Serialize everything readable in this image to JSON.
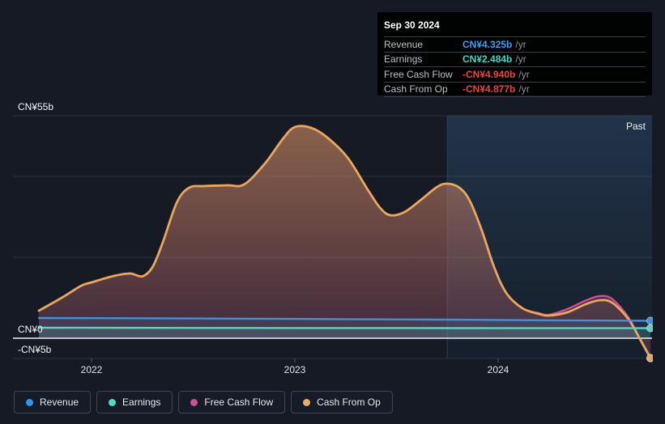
{
  "tooltip": {
    "date": "Sep 30 2024",
    "rows": [
      {
        "label": "Revenue",
        "value": "CN¥4.325b",
        "suffix": "/yr",
        "value_color": "#3aa0f4"
      },
      {
        "label": "Earnings",
        "value": "CN¥2.484b",
        "suffix": "/yr",
        "value_color": "#3fd6c6"
      },
      {
        "label": "Free Cash Flow",
        "value": "-CN¥4.940b",
        "suffix": "/yr",
        "value_color": "#e8453e"
      },
      {
        "label": "Cash From Op",
        "value": "-CN¥4.877b",
        "suffix": "/yr",
        "value_color": "#e8453e"
      }
    ]
  },
  "legend": {
    "items": [
      {
        "label": "Revenue",
        "color": "#2b97f1"
      },
      {
        "label": "Earnings",
        "color": "#4fdcc7"
      },
      {
        "label": "Free Cash Flow",
        "color": "#cf4e96"
      },
      {
        "label": "Cash From Op",
        "color": "#e9ae5a"
      }
    ]
  },
  "chart": {
    "past_label": "Past",
    "y_axis_labels": [
      {
        "value": 55,
        "label": "CN¥55b"
      },
      {
        "value": 0,
        "label": "CN¥0"
      },
      {
        "value": -5,
        "label": "-CN¥5b"
      }
    ],
    "x_axis_labels": [
      {
        "t": 2022,
        "label": "2022"
      },
      {
        "t": 2023,
        "label": "2023"
      },
      {
        "t": 2024,
        "label": "2024"
      }
    ]
  },
  "chart_data": {
    "type": "area",
    "title": "Past earnings and revenue history",
    "x_unit": "decimal_year",
    "y_unit": "CN¥ billions",
    "xlim": [
      2021.6,
      2024.78
    ],
    "ylim": [
      -5,
      55
    ],
    "gridlines_y": [
      55,
      40,
      20,
      -5
    ],
    "zero_line_y": 0,
    "past_band_start": 2023.75,
    "legend_position": "bottom",
    "end_values": {
      "revenue": 4.325,
      "earnings": 2.484,
      "free_cash_flow": -4.94,
      "cash_from_op": -4.877
    },
    "series": [
      {
        "name": "Free Cash Flow",
        "color": "#cf4e96",
        "width": 2.4,
        "fill_opacity": 0.2,
        "dot": true,
        "points": [
          [
            2021.741,
            6.8
          ],
          [
            2021.86,
            10.2
          ],
          [
            2021.95,
            13.0
          ],
          [
            2022.0,
            13.8
          ],
          [
            2022.11,
            15.4
          ],
          [
            2022.19,
            16.0
          ],
          [
            2022.25,
            15.3
          ],
          [
            2022.3,
            17.6
          ],
          [
            2022.35,
            23.6
          ],
          [
            2022.42,
            33.6
          ],
          [
            2022.48,
            37.2
          ],
          [
            2022.55,
            37.6
          ],
          [
            2022.67,
            37.8
          ],
          [
            2022.75,
            38.0
          ],
          [
            2022.85,
            43.0
          ],
          [
            2022.94,
            49.2
          ],
          [
            2023.0,
            52.2
          ],
          [
            2023.08,
            52.0
          ],
          [
            2023.16,
            49.6
          ],
          [
            2023.26,
            44.6
          ],
          [
            2023.36,
            36.6
          ],
          [
            2023.42,
            32.2
          ],
          [
            2023.47,
            30.4
          ],
          [
            2023.54,
            31.2
          ],
          [
            2023.62,
            34.2
          ],
          [
            2023.7,
            37.4
          ],
          [
            2023.75,
            38.2
          ],
          [
            2023.81,
            37.2
          ],
          [
            2023.86,
            34.0
          ],
          [
            2023.92,
            26.6
          ],
          [
            2023.98,
            17.6
          ],
          [
            2024.04,
            11.2
          ],
          [
            2024.12,
            7.4
          ],
          [
            2024.2,
            6.2
          ],
          [
            2024.25,
            5.8
          ],
          [
            2024.34,
            7.2
          ],
          [
            2024.43,
            9.3
          ],
          [
            2024.5,
            10.4
          ],
          [
            2024.56,
            9.7
          ],
          [
            2024.64,
            5.2
          ],
          [
            2024.7,
            -0.5
          ],
          [
            2024.749,
            -4.94
          ]
        ]
      },
      {
        "name": "Cash From Op",
        "color": "#e8a75e",
        "width": 2.8,
        "fill": "gradient",
        "dot": true,
        "points": [
          [
            2021.741,
            6.8
          ],
          [
            2021.86,
            10.2
          ],
          [
            2021.95,
            13.0
          ],
          [
            2022.0,
            13.8
          ],
          [
            2022.11,
            15.4
          ],
          [
            2022.19,
            16.0
          ],
          [
            2022.25,
            15.3
          ],
          [
            2022.3,
            17.6
          ],
          [
            2022.35,
            23.6
          ],
          [
            2022.42,
            33.6
          ],
          [
            2022.48,
            37.2
          ],
          [
            2022.55,
            37.6
          ],
          [
            2022.67,
            37.8
          ],
          [
            2022.75,
            38.0
          ],
          [
            2022.85,
            43.0
          ],
          [
            2022.94,
            49.2
          ],
          [
            2023.0,
            52.2
          ],
          [
            2023.08,
            52.0
          ],
          [
            2023.16,
            49.6
          ],
          [
            2023.26,
            44.6
          ],
          [
            2023.36,
            36.6
          ],
          [
            2023.42,
            32.2
          ],
          [
            2023.47,
            30.4
          ],
          [
            2023.54,
            31.2
          ],
          [
            2023.62,
            34.2
          ],
          [
            2023.7,
            37.4
          ],
          [
            2023.75,
            38.2
          ],
          [
            2023.81,
            37.2
          ],
          [
            2023.86,
            34.0
          ],
          [
            2023.92,
            26.6
          ],
          [
            2023.98,
            17.6
          ],
          [
            2024.04,
            11.2
          ],
          [
            2024.12,
            7.4
          ],
          [
            2024.2,
            6.0
          ],
          [
            2024.25,
            5.6
          ],
          [
            2024.34,
            6.4
          ],
          [
            2024.43,
            8.4
          ],
          [
            2024.5,
            9.4
          ],
          [
            2024.56,
            8.8
          ],
          [
            2024.64,
            4.8
          ],
          [
            2024.7,
            -0.4
          ],
          [
            2024.749,
            -4.877
          ]
        ]
      },
      {
        "name": "Revenue",
        "color": "#4590d6",
        "width": 2.4,
        "fill_opacity": 0.15,
        "dot": true,
        "points": [
          [
            2021.741,
            5.0
          ],
          [
            2022.2,
            4.95
          ],
          [
            2022.7,
            4.85
          ],
          [
            2023.2,
            4.72
          ],
          [
            2023.7,
            4.6
          ],
          [
            2024.2,
            4.45
          ],
          [
            2024.749,
            4.325
          ]
        ]
      },
      {
        "name": "Earnings",
        "color": "#63cfbe",
        "width": 2.4,
        "fill_opacity": 0.16,
        "dot": true,
        "points": [
          [
            2021.741,
            2.6
          ],
          [
            2022.3,
            2.56
          ],
          [
            2023.0,
            2.52
          ],
          [
            2023.7,
            2.5
          ],
          [
            2024.3,
            2.49
          ],
          [
            2024.749,
            2.484
          ]
        ]
      }
    ]
  }
}
